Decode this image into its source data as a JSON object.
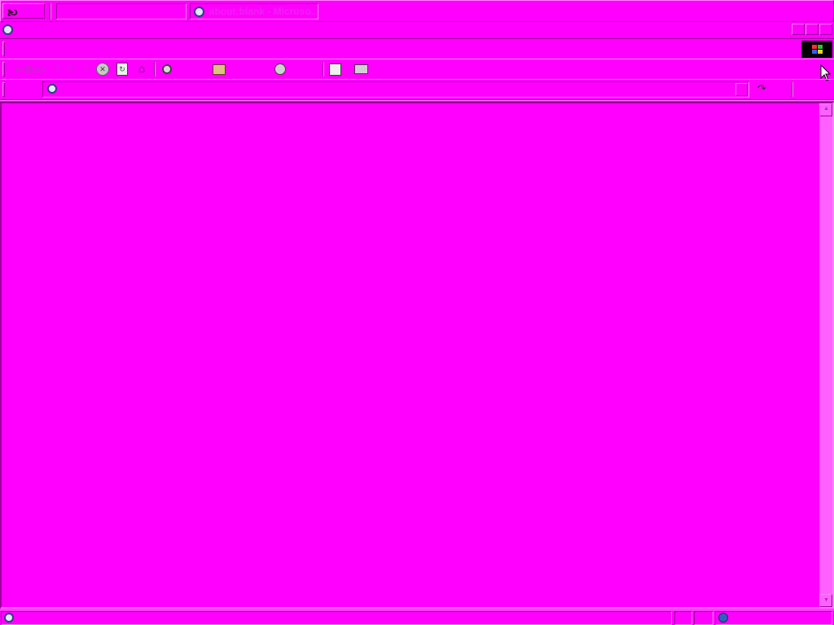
{
  "taskbar": {
    "start_icon": "start-icon",
    "task_title": "about:blank - Microso..."
  },
  "toolbar": {
    "back_label": "Back"
  },
  "colors": {
    "background": "#ff00ff",
    "shadow": "#a000a0",
    "highlight": "#ff80ff",
    "brand_tile": "#000000"
  }
}
